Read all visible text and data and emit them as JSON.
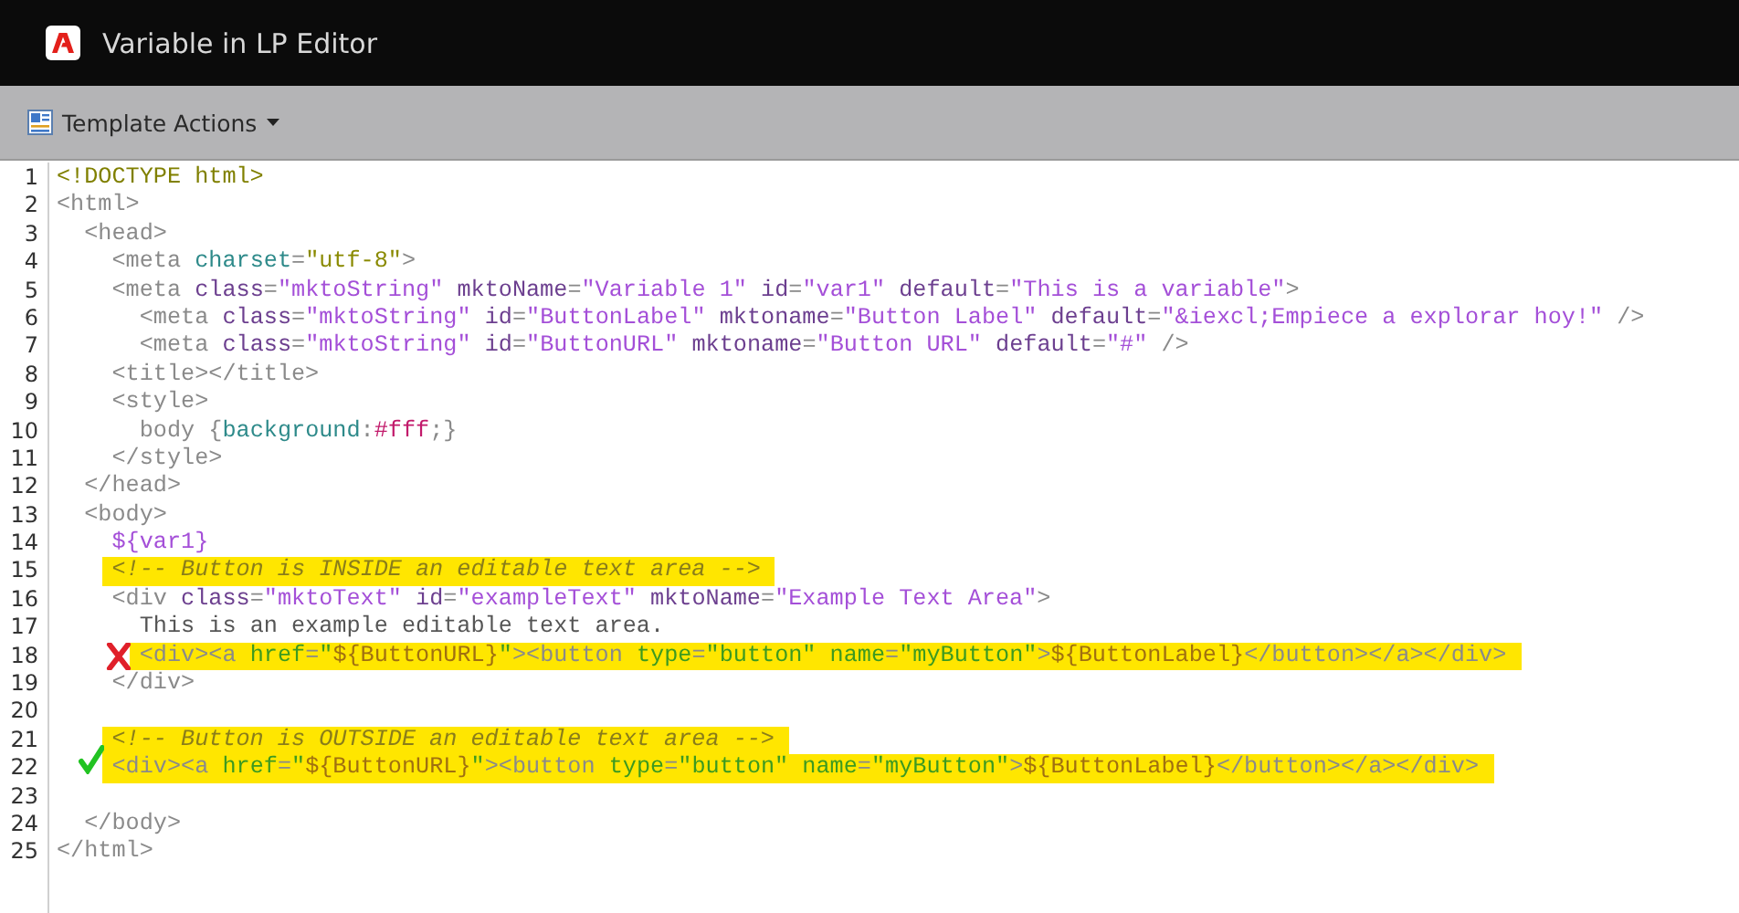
{
  "window": {
    "title": "Variable in LP Editor"
  },
  "toolbar": {
    "menu_label": "Template Actions"
  },
  "editor": {
    "lines": [
      {
        "number": "1",
        "kind": "plain",
        "highlighted": false,
        "tokens": [
          {
            "kind": "doctype",
            "text": "<!DOCTYPE html>"
          }
        ]
      },
      {
        "number": "2",
        "kind": "plain",
        "highlighted": false,
        "tokens": [
          {
            "kind": "tag",
            "text": "<html>"
          }
        ]
      },
      {
        "number": "3",
        "kind": "plain",
        "highlighted": false,
        "tokens": [
          {
            "kind": "tag",
            "text": "  <head>"
          }
        ]
      },
      {
        "number": "4",
        "kind": "plain",
        "highlighted": false,
        "tokens": [
          {
            "kind": "tag",
            "text": "    <meta "
          },
          {
            "kind": "attr_teal",
            "text": "charset"
          },
          {
            "kind": "tag",
            "text": "="
          },
          {
            "kind": "value",
            "text": "\"utf-8\""
          },
          {
            "kind": "tag",
            "text": ">"
          }
        ]
      },
      {
        "number": "5",
        "kind": "plain",
        "highlighted": false,
        "tokens": [
          {
            "kind": "tag",
            "text": "    <meta "
          },
          {
            "kind": "attr",
            "text": "class"
          },
          {
            "kind": "tag",
            "text": "="
          },
          {
            "kind": "string",
            "text": "\"mktoString\""
          },
          {
            "kind": "attr",
            "text": " mktoName"
          },
          {
            "kind": "tag",
            "text": "="
          },
          {
            "kind": "string",
            "text": "\"Variable 1\""
          },
          {
            "kind": "attr",
            "text": " id"
          },
          {
            "kind": "tag",
            "text": "="
          },
          {
            "kind": "string",
            "text": "\"var1\""
          },
          {
            "kind": "attr",
            "text": " default"
          },
          {
            "kind": "tag",
            "text": "="
          },
          {
            "kind": "string",
            "text": "\"This is a variable\""
          },
          {
            "kind": "tag",
            "text": ">"
          }
        ]
      },
      {
        "number": "6",
        "kind": "plain",
        "highlighted": false,
        "tokens": [
          {
            "kind": "tag",
            "text": "      <meta "
          },
          {
            "kind": "attr",
            "text": "class"
          },
          {
            "kind": "tag",
            "text": "="
          },
          {
            "kind": "string",
            "text": "\"mktoString\""
          },
          {
            "kind": "attr",
            "text": " id"
          },
          {
            "kind": "tag",
            "text": "="
          },
          {
            "kind": "string",
            "text": "\"ButtonLabel\""
          },
          {
            "kind": "attr",
            "text": " mktoname"
          },
          {
            "kind": "tag",
            "text": "="
          },
          {
            "kind": "string",
            "text": "\"Button Label\""
          },
          {
            "kind": "attr",
            "text": " default"
          },
          {
            "kind": "tag",
            "text": "="
          },
          {
            "kind": "string",
            "text": "\"&iexcl;Empiece a explorar hoy!\""
          },
          {
            "kind": "tag",
            "text": " />"
          }
        ]
      },
      {
        "number": "7",
        "kind": "plain",
        "highlighted": false,
        "tokens": [
          {
            "kind": "tag",
            "text": "      <meta "
          },
          {
            "kind": "attr",
            "text": "class"
          },
          {
            "kind": "tag",
            "text": "="
          },
          {
            "kind": "string",
            "text": "\"mktoString\""
          },
          {
            "kind": "attr",
            "text": " id"
          },
          {
            "kind": "tag",
            "text": "="
          },
          {
            "kind": "string",
            "text": "\"ButtonURL\""
          },
          {
            "kind": "attr",
            "text": " mktoname"
          },
          {
            "kind": "tag",
            "text": "="
          },
          {
            "kind": "string",
            "text": "\"Button URL\""
          },
          {
            "kind": "attr",
            "text": " default"
          },
          {
            "kind": "tag",
            "text": "="
          },
          {
            "kind": "string",
            "text": "\"#\""
          },
          {
            "kind": "tag",
            "text": " />"
          }
        ]
      },
      {
        "number": "8",
        "kind": "plain",
        "highlighted": false,
        "tokens": [
          {
            "kind": "tag",
            "text": "    <title></title>"
          }
        ]
      },
      {
        "number": "9",
        "kind": "plain",
        "highlighted": false,
        "tokens": [
          {
            "kind": "tag",
            "text": "    <style>"
          }
        ]
      },
      {
        "number": "10",
        "kind": "plain",
        "highlighted": false,
        "tokens": [
          {
            "kind": "tag",
            "text": "      body {"
          },
          {
            "kind": "attr_teal",
            "text": "background"
          },
          {
            "kind": "tag",
            "text": ":"
          },
          {
            "kind": "css_value",
            "text": "#fff"
          },
          {
            "kind": "tag",
            "text": ";}"
          }
        ]
      },
      {
        "number": "11",
        "kind": "plain",
        "highlighted": false,
        "tokens": [
          {
            "kind": "tag",
            "text": "    </style>"
          }
        ]
      },
      {
        "number": "12",
        "kind": "plain",
        "highlighted": false,
        "tokens": [
          {
            "kind": "tag",
            "text": "  </head>"
          }
        ]
      },
      {
        "number": "13",
        "kind": "plain",
        "highlighted": false,
        "tokens": [
          {
            "kind": "tag",
            "text": "  <body>"
          }
        ]
      },
      {
        "number": "14",
        "kind": "plain",
        "highlighted": false,
        "tokens": [
          {
            "kind": "string",
            "text": "    ${var1}"
          }
        ]
      },
      {
        "number": "15",
        "kind": "plain",
        "highlighted": true,
        "tokens": [
          {
            "kind": "comment",
            "text": "    <!-- Button is INSIDE an editable text area -->"
          }
        ]
      },
      {
        "number": "16",
        "kind": "plain",
        "highlighted": false,
        "tokens": [
          {
            "kind": "tag",
            "text": "    <div "
          },
          {
            "kind": "attr",
            "text": "class"
          },
          {
            "kind": "tag",
            "text": "="
          },
          {
            "kind": "string",
            "text": "\"mktoText\""
          },
          {
            "kind": "attr",
            "text": " id"
          },
          {
            "kind": "tag",
            "text": "="
          },
          {
            "kind": "string",
            "text": "\"exampleText\""
          },
          {
            "kind": "attr",
            "text": " mktoName"
          },
          {
            "kind": "tag",
            "text": "="
          },
          {
            "kind": "string",
            "text": "\"Example Text Area\""
          },
          {
            "kind": "tag",
            "text": ">"
          }
        ]
      },
      {
        "number": "17",
        "kind": "plain",
        "highlighted": false,
        "tokens": [
          {
            "kind": "text",
            "text": "      This is an example editable text area."
          }
        ]
      },
      {
        "number": "18",
        "kind": "cross",
        "highlighted": true,
        "tokens": [
          {
            "kind": "tag",
            "text": "      <div><a "
          },
          {
            "kind": "attr_green",
            "text": "href"
          },
          {
            "kind": "tag",
            "text": "="
          },
          {
            "kind": "string_green",
            "text": "\""
          },
          {
            "kind": "variable",
            "text": "${ButtonURL}"
          },
          {
            "kind": "string_green",
            "text": "\""
          },
          {
            "kind": "tag",
            "text": "><button "
          },
          {
            "kind": "attr_green",
            "text": "type"
          },
          {
            "kind": "tag",
            "text": "="
          },
          {
            "kind": "string_green",
            "text": "\"button\""
          },
          {
            "kind": "attr_green",
            "text": " name"
          },
          {
            "kind": "tag",
            "text": "="
          },
          {
            "kind": "string_green",
            "text": "\"myButton\""
          },
          {
            "kind": "tag",
            "text": ">"
          },
          {
            "kind": "variable",
            "text": "${ButtonLabel}"
          },
          {
            "kind": "tag",
            "text": "</button></a></div>"
          }
        ]
      },
      {
        "number": "19",
        "kind": "plain",
        "highlighted": false,
        "tokens": [
          {
            "kind": "tag",
            "text": "    </div>"
          }
        ]
      },
      {
        "number": "20",
        "kind": "plain",
        "highlighted": false
      },
      {
        "number": "21",
        "kind": "plain",
        "highlighted": true,
        "tokens": [
          {
            "kind": "comment",
            "text": "    <!-- Button is OUTSIDE an editable text area -->"
          }
        ]
      },
      {
        "number": "22",
        "kind": "check",
        "highlighted": true,
        "tokens": [
          {
            "kind": "tag",
            "text": "    <div><a "
          },
          {
            "kind": "attr_green",
            "text": "href"
          },
          {
            "kind": "tag",
            "text": "="
          },
          {
            "kind": "string_green",
            "text": "\""
          },
          {
            "kind": "variable",
            "text": "${ButtonURL}"
          },
          {
            "kind": "string_green",
            "text": "\""
          },
          {
            "kind": "tag",
            "text": "><button "
          },
          {
            "kind": "attr_green",
            "text": "type"
          },
          {
            "kind": "tag",
            "text": "="
          },
          {
            "kind": "string_green",
            "text": "\"button\""
          },
          {
            "kind": "attr_green",
            "text": " name"
          },
          {
            "kind": "tag",
            "text": "="
          },
          {
            "kind": "string_green",
            "text": "\"myButton\""
          },
          {
            "kind": "tag",
            "text": ">"
          },
          {
            "kind": "variable",
            "text": "${ButtonLabel}"
          },
          {
            "kind": "tag",
            "text": "</button></a></div>"
          }
        ]
      },
      {
        "number": "23",
        "kind": "plain",
        "highlighted": false
      },
      {
        "number": "24",
        "kind": "plain",
        "highlighted": false,
        "tokens": [
          {
            "kind": "tag",
            "text": "  </body>"
          }
        ]
      },
      {
        "number": "25",
        "kind": "plain",
        "highlighted": false,
        "tokens": [
          {
            "kind": "tag",
            "text": "</html>"
          }
        ]
      }
    ]
  }
}
